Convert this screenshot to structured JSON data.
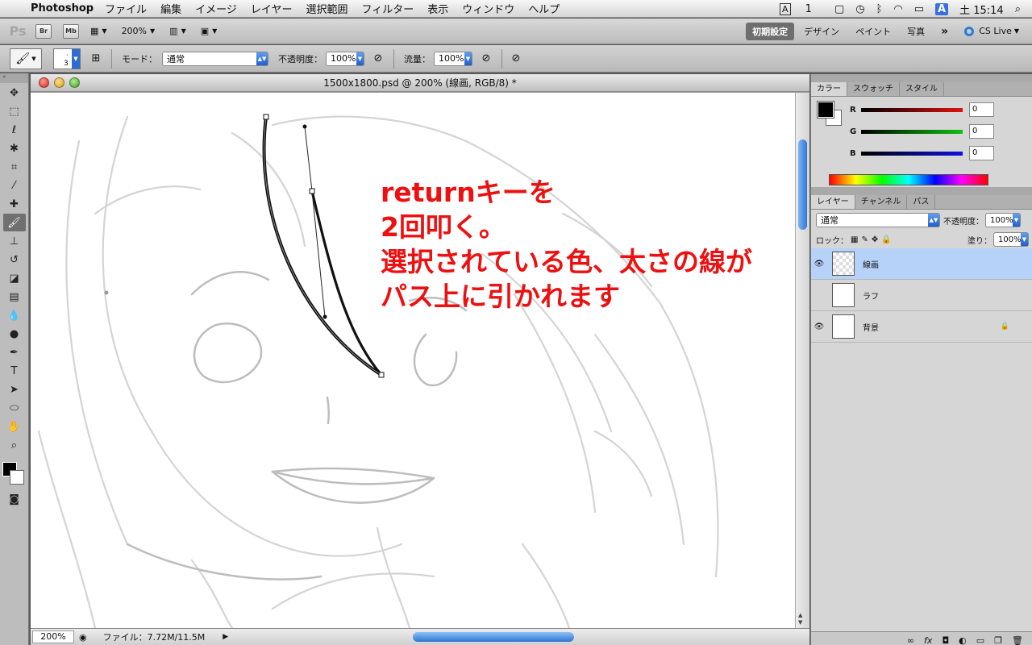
{
  "menubar": {
    "app_name": "Photoshop",
    "items": [
      "ファイル",
      "編集",
      "イメージ",
      "レイヤー",
      "選択範囲",
      "フィルター",
      "表示",
      "ウィンドウ",
      "ヘルプ"
    ],
    "input_label": "A",
    "input_num": "1",
    "input_method": "A",
    "clock": "土 15:14"
  },
  "appbar": {
    "logo": "Ps",
    "br": "Br",
    "mb": "Mb",
    "zoom": "200%",
    "workspaces": [
      "初期設定",
      "デザイン",
      "ペイント",
      "写真"
    ],
    "more": "»",
    "cs_live": "CS Live"
  },
  "options": {
    "brush_size": "3",
    "mode_label": "モード：",
    "mode_value": "通常",
    "opacity_label": "不透明度：",
    "opacity_value": "100%",
    "flow_label": "流量：",
    "flow_value": "100%"
  },
  "document": {
    "title": "1500x1800.psd @ 200% (線画, RGB/8) *",
    "annotation": [
      "returnキーを",
      "2回叩く。",
      "選択されている色、太さの線が",
      "パス上に引かれます"
    ],
    "status_zoom": "200%",
    "status_file": "ファイル：7.72M/11.5M"
  },
  "color_panel": {
    "tabs": [
      "カラー",
      "スウォッチ",
      "スタイル"
    ],
    "channels": [
      {
        "label": "R",
        "value": "0",
        "color": "#e01010"
      },
      {
        "label": "G",
        "value": "0",
        "color": "#10c010"
      },
      {
        "label": "B",
        "value": "0",
        "color": "#1010e0"
      }
    ]
  },
  "layers_panel": {
    "tabs": [
      "レイヤー",
      "チャンネル",
      "パス"
    ],
    "blend_mode": "通常",
    "opacity_label": "不透明度：",
    "opacity_value": "100%",
    "lock_label": "ロック：",
    "fill_label": "塗り：",
    "fill_value": "100%",
    "layers": [
      {
        "name": "線画"
      },
      {
        "name": "ラフ"
      },
      {
        "name": "背景"
      }
    ]
  },
  "colors": {
    "annotation_red": "#ee1010",
    "selection_blue": "#b6d2f9",
    "accent_blue": "#2e75d6"
  }
}
